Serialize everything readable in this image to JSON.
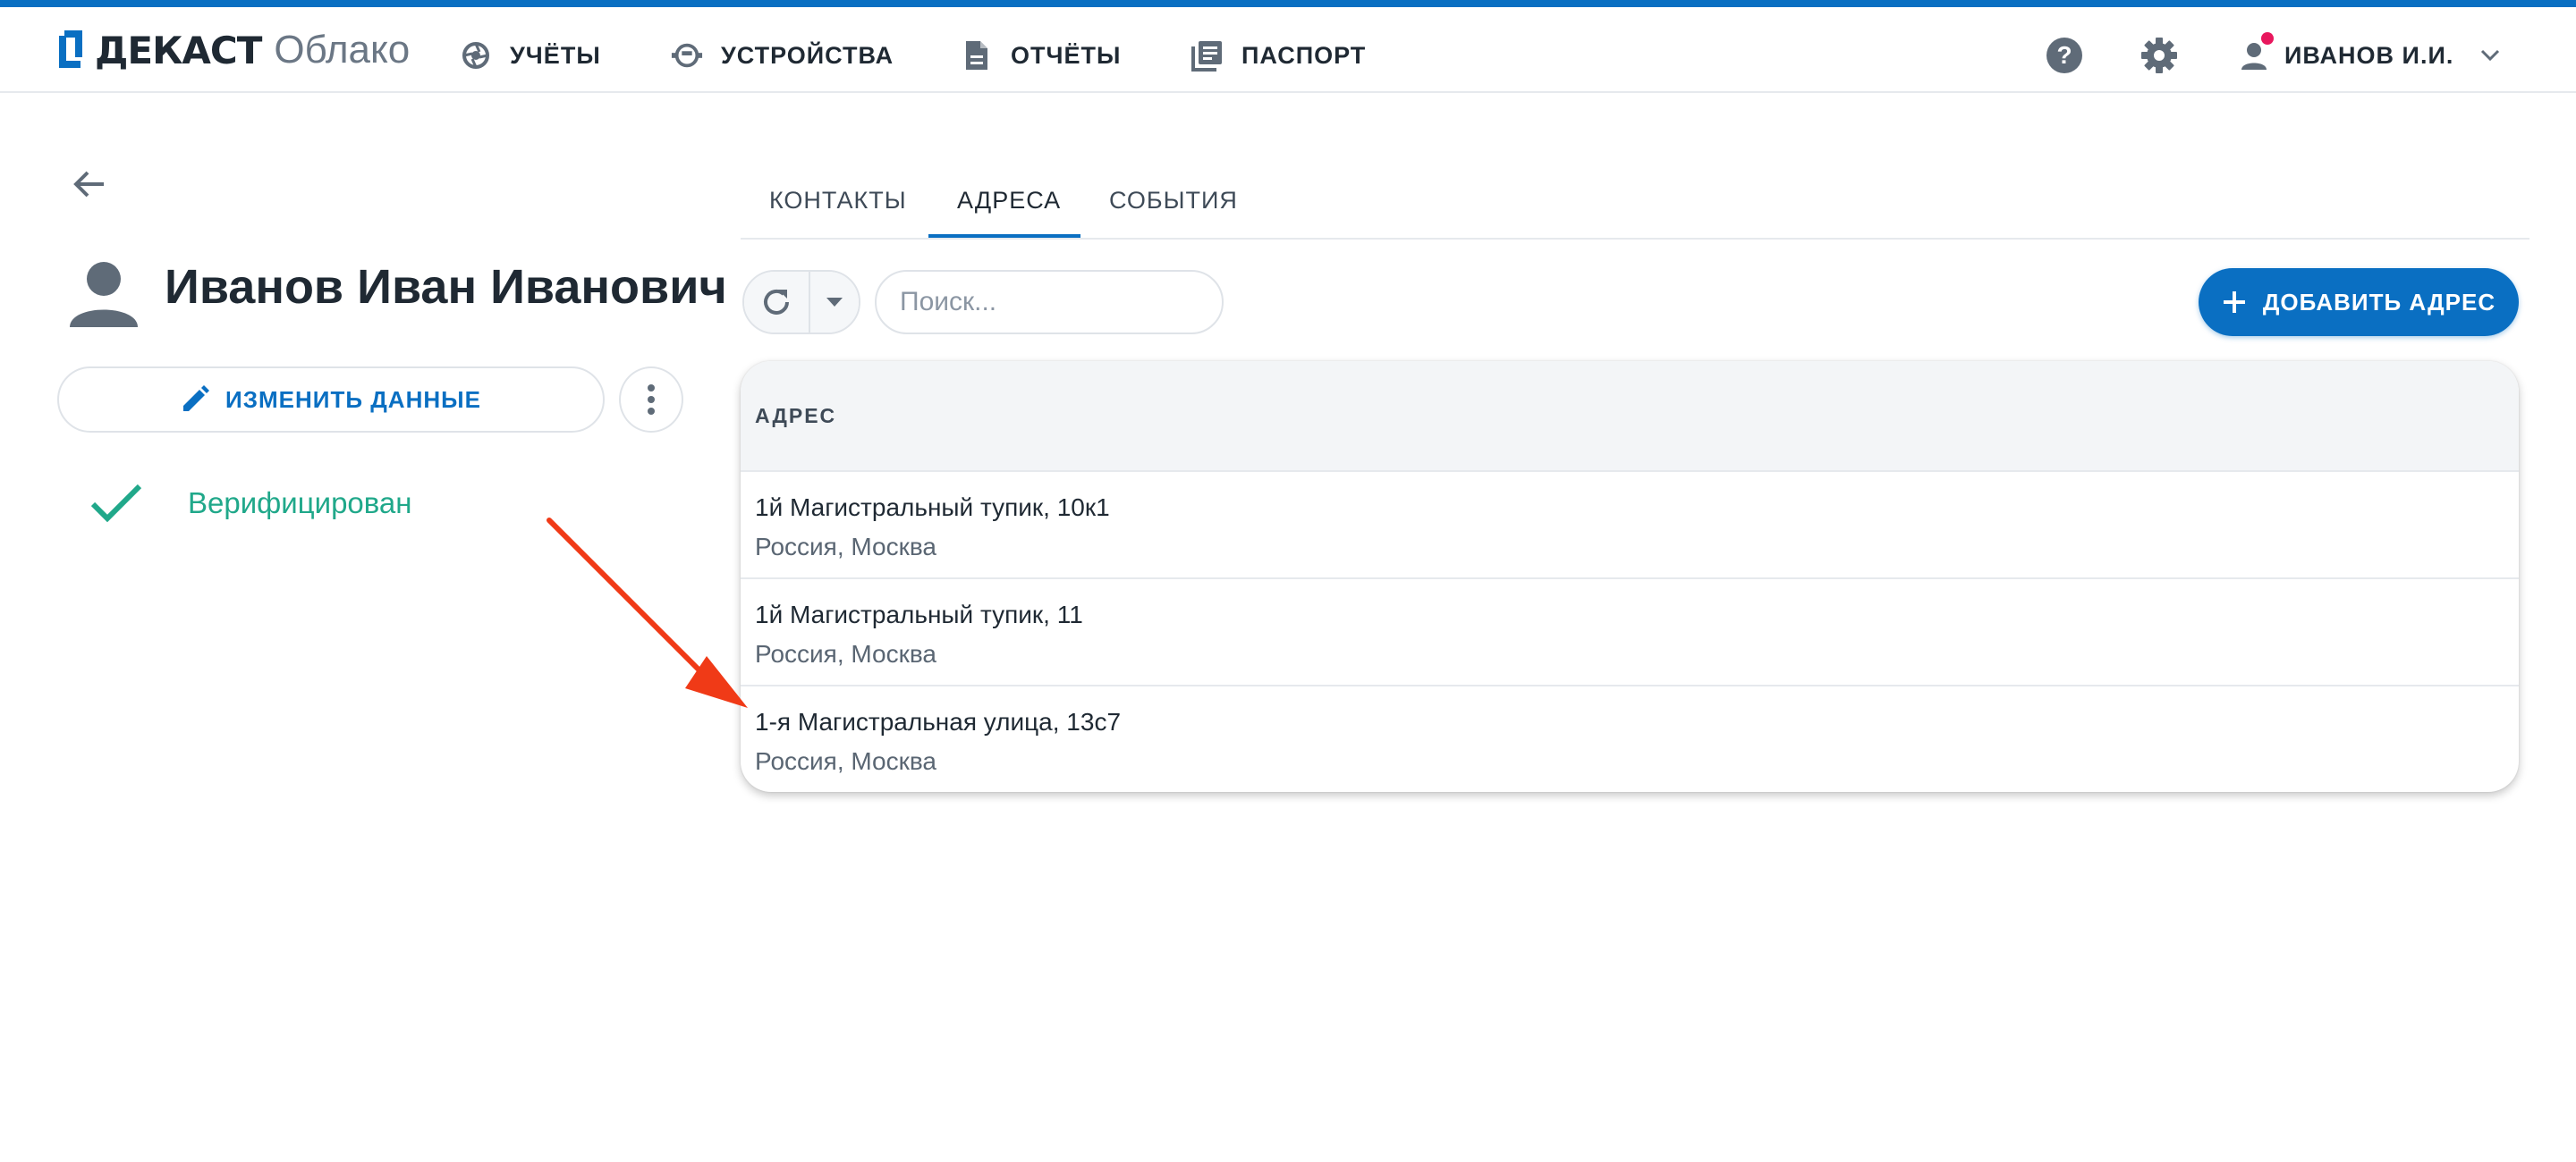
{
  "app": {
    "brand": "ДЕКАСТ",
    "brand_sub": "Облако",
    "accent_color": "#0a6fc2"
  },
  "nav": {
    "items": [
      {
        "label": "УЧЁТЫ",
        "icon": "aperture-icon"
      },
      {
        "label": "УСТРОЙСТВА",
        "icon": "meter-icon"
      },
      {
        "label": "ОТЧЁТЫ",
        "icon": "document-icon"
      },
      {
        "label": "ПАСПОРТ",
        "icon": "library-books-icon"
      }
    ]
  },
  "header": {
    "help_icon": "help-icon",
    "settings_icon": "gear-icon",
    "user_name": "ИВАНОВ И.И."
  },
  "profile": {
    "name": "Иванов Иван Иванович",
    "edit_label": "ИЗМЕНИТЬ ДАННЫЕ",
    "status": "Верифицирован"
  },
  "tabs": [
    {
      "label": "КОНТАКТЫ",
      "active": false
    },
    {
      "label": "АДРЕСА",
      "active": true
    },
    {
      "label": "СОБЫТИЯ",
      "active": false
    }
  ],
  "toolbar": {
    "search_placeholder": "Поиск...",
    "add_label": "ДОБАВИТЬ АДРЕС"
  },
  "table": {
    "column": "АДРЕС",
    "rows": [
      {
        "street": "1й Магистральный тупик, 10к1",
        "city": "Россия, Москва"
      },
      {
        "street": "1й Магистральный тупик, 11",
        "city": "Россия, Москва"
      },
      {
        "street": "1-я Магистральная улица, 13с7",
        "city": "Россия, Москва"
      }
    ]
  },
  "colors": {
    "verified": "#20a88a",
    "annotation_arrow": "#f03a17",
    "notification_dot": "#e8175d"
  }
}
